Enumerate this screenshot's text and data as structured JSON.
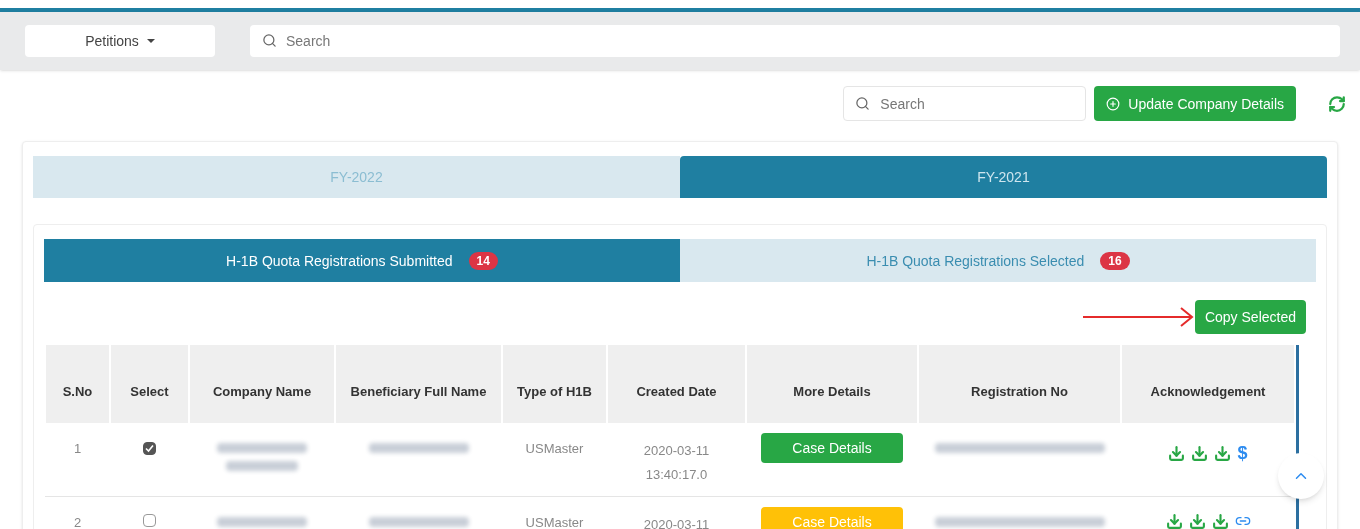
{
  "header": {
    "menu": {
      "label": "Petitions"
    },
    "search": {
      "placeholder": "Search"
    }
  },
  "toolbar": {
    "search": {
      "placeholder": "Search"
    },
    "update_button": "Update Company Details"
  },
  "year_tabs": [
    {
      "label": "FY-2022",
      "selected": false
    },
    {
      "label": "FY-2021",
      "selected": true
    }
  ],
  "sub_tabs": [
    {
      "label": "H-1B Quota Registrations Submitted",
      "count": "14",
      "selected": true
    },
    {
      "label": "H-1B Quota Registrations Selected",
      "count": "16",
      "selected": false
    }
  ],
  "copy_button": "Copy Selected",
  "table": {
    "columns": [
      "S.No",
      "Select",
      "Company Name",
      "Beneficiary Full Name",
      "Type of H1B",
      "Created Date",
      "More Details",
      "Registration No",
      "Acknowledgement"
    ],
    "rows": [
      {
        "sno": "1",
        "selected": true,
        "type": "USMaster",
        "created": [
          "2020-03-11",
          "13:40:17.0"
        ],
        "details": {
          "label": "Case Details",
          "color": "#28a745"
        },
        "payment_mark": "$"
      },
      {
        "sno": "2",
        "selected": false,
        "type": "USMaster",
        "created": [
          "2020-03-11"
        ],
        "details": {
          "label": "Case Details",
          "color": "#ffc107"
        }
      }
    ]
  }
}
